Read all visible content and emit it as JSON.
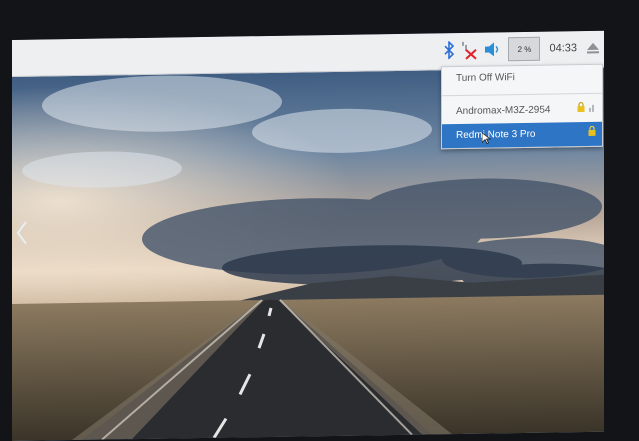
{
  "taskbar": {
    "cpu_label": "2 %",
    "clock": "04:33",
    "icons": [
      "bluetooth-icon",
      "wifi-disconnected-icon",
      "volume-icon",
      "eject-icon"
    ]
  },
  "wifi_menu": {
    "turn_off": "Turn Off WiFi",
    "networks": [
      {
        "name": "Andromax-M3Z-2954",
        "locked": true,
        "selected": false
      },
      {
        "name": "Redmi Note 3 Pro",
        "locked": true,
        "selected": true
      }
    ]
  },
  "colors": {
    "taskbar": "#eeeff1",
    "menu_highlight": "#2f75c6",
    "bluetooth": "#2a6fd6",
    "wifi_error": "#e0202a",
    "lock": "#e8c020"
  }
}
